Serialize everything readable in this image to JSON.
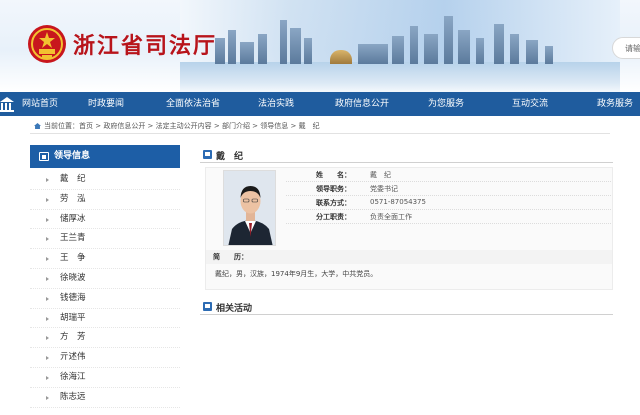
{
  "header": {
    "site_title": "浙江省司法厅",
    "search_placeholder": "请输"
  },
  "nav": {
    "items": [
      "网站首页",
      "时政要闻",
      "全面依法治省",
      "法治实践",
      "政府信息公开",
      "为您服务",
      "互动交流",
      "政务服务"
    ]
  },
  "breadcrumb": {
    "text": "当前位置：首页 > 政府信息公开 > 法定主动公开内容 > 部门介绍 > 领导信息 > 戴　纪"
  },
  "sidebar": {
    "title": "领导信息",
    "items": [
      "戴　纪",
      "劳　泓",
      "储厚冰",
      "王兰青",
      "王　争",
      "徐晓波",
      "钱德海",
      "胡瑞平",
      "方　芳",
      "亓述伟",
      "徐海江",
      "陈志远"
    ]
  },
  "profile": {
    "section_title": "戴　纪",
    "name_label": "姓　　名：",
    "name_value": "戴　纪",
    "position_label": "领导职务：",
    "position_value": "党委书记",
    "contact_label": "联系方式：",
    "contact_value": "0571-87054375",
    "duty_label": "分工职责：",
    "duty_value": "负责全面工作",
    "bio_label": "简　　历：",
    "bio_text": "戴纪，男，汉族，1974年9月生，大学，中共党员。"
  },
  "related": {
    "section_title": "相关活动"
  },
  "colors": {
    "nav_bg": "#1f5c9e",
    "title_red": "#b8141b",
    "sidebar_header": "#1d5ea6"
  }
}
